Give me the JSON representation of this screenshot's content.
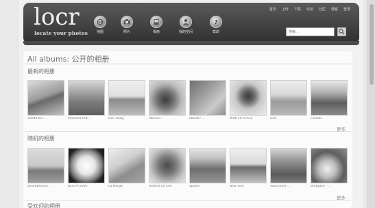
{
  "site": {
    "logo": "locr",
    "tagline": "locate your photos"
  },
  "nav": [
    {
      "label": "地图",
      "icon": "globe-icon"
    },
    {
      "label": "照片",
      "icon": "camera-icon"
    },
    {
      "label": "相册",
      "icon": "album-icon"
    },
    {
      "label": "我的空间",
      "icon": "user-icon"
    },
    {
      "label": "帮助",
      "icon": "help-icon"
    }
  ],
  "toplinks": [
    "首页",
    "上传",
    "下载",
    "论坛",
    "社区",
    "博客",
    "登录"
  ],
  "search": {
    "placeholder": "搜索...",
    "icon": "search-icon"
  },
  "page_title": "All albums: 公开的相册",
  "sections": [
    {
      "title": "最新的相册",
      "more": "更多",
      "albums": [
        {
          "caption": "20080301 ..."
        },
        {
          "caption": "Shaoxha Old ..."
        },
        {
          "caption": "Den Haag"
        },
        {
          "caption": "080303 ..."
        },
        {
          "caption": "080307 ..."
        },
        {
          "caption": "WINTER PLACE"
        },
        {
          "caption": "Golf"
        },
        {
          "caption": "Canada"
        }
      ]
    },
    {
      "title": "随机的相册",
      "more": "更多",
      "albums": [
        {
          "caption": "Strombecken ..."
        },
        {
          "caption": "BCG-PI-2006"
        },
        {
          "caption": "La Marga"
        },
        {
          "caption": "Hertest im Elm"
        },
        {
          "caption": "Speyer"
        },
        {
          "caption": "New York"
        },
        {
          "caption": "Vancouver ..."
        },
        {
          "caption": "Bretagne - ..."
        }
      ]
    },
    {
      "title": "受欢迎的相册"
    }
  ]
}
